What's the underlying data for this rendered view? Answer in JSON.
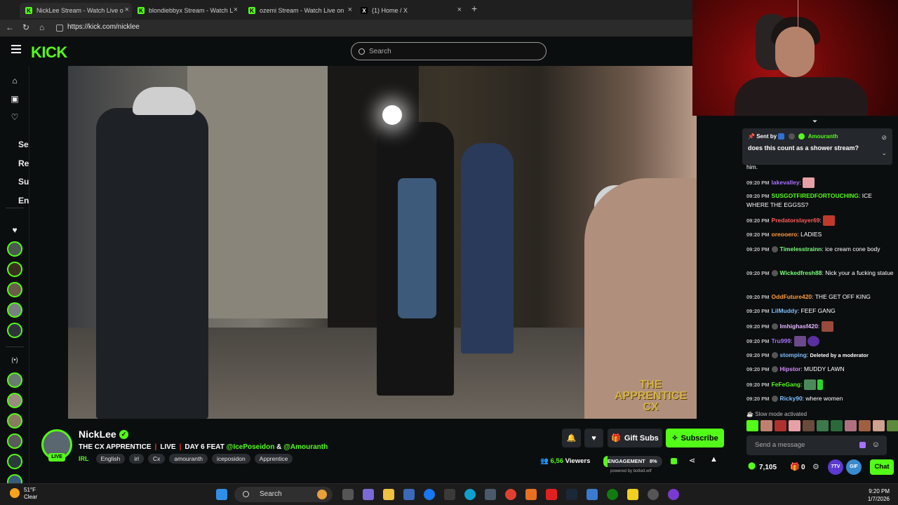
{
  "browser": {
    "tabs": [
      {
        "label": "NickLee Stream - Watch Live o",
        "active": true
      },
      {
        "label": "blondiebbyx Stream - Watch L",
        "active": false
      },
      {
        "label": "ozemi Stream - Watch Live on",
        "active": false
      },
      {
        "label": "(1) Home / X",
        "active": false
      }
    ],
    "new_tab": "+",
    "url": "https://kick.com/nicklee"
  },
  "kick": {
    "logo": "KICK",
    "search_placeholder": "Search",
    "accent": "#53fc18"
  },
  "sidebar": {
    "nav_icons": [
      "home-icon",
      "browse-icon",
      "following-icon"
    ],
    "sections": [
      "Se",
      "Re",
      "Su",
      "En"
    ],
    "live_icon": "(•)"
  },
  "video": {
    "watermark_line1": "THE",
    "watermark_line2": "APPRENTICE",
    "watermark_line3": "CX"
  },
  "chat": {
    "pinned_sent_by": "Sent by",
    "pinned_user": "Amouranth",
    "pinned_message": "does this count as a shower stream?",
    "overflow_text": "him.",
    "messages": [
      {
        "time": "09:20 PM",
        "user": "lakevalley",
        "color": "#a970ff",
        "text": ""
      },
      {
        "time": "09:20 PM",
        "user": "SUSGOTFIREDFORTOUCHING",
        "color": "#53fc18",
        "text": "ICE WHERE THE EGGSS?"
      },
      {
        "time": "09:20 PM",
        "user": "Predatorslayer69",
        "color": "#ff5a5a",
        "text": ""
      },
      {
        "time": "09:20 PM",
        "user": "oreooero",
        "color": "#ff9a3c",
        "text": "LADIES"
      },
      {
        "time": "09:20 PM",
        "user": "Timelesstrainn",
        "color": "#7dff7d",
        "text": "ice cream cone body"
      },
      {
        "time": "09:20 PM",
        "user": "Wickedfresh88",
        "color": "#7dff7d",
        "text": "Nick your a fucking statue"
      },
      {
        "time": "09:20 PM",
        "user": "OddFuture420",
        "color": "#ff9a3c",
        "text": "THE GET OFF KING"
      },
      {
        "time": "09:20 PM",
        "user": "LilMuddy",
        "color": "#7fbfff",
        "text": "FEEF GANG"
      },
      {
        "time": "09:20 PM",
        "user": "Imhighasf420",
        "color": "#e6b8ff",
        "text": ""
      },
      {
        "time": "09:20 PM",
        "user": "Tru999",
        "color": "#a970ff",
        "text": ""
      },
      {
        "time": "09:20 PM",
        "user": "stomping",
        "color": "#7fbfff",
        "text": "Deleted by a moderator"
      },
      {
        "time": "09:20 PM",
        "user": "Hipstor",
        "color": "#d58bff",
        "text": "MUDDY LAWN"
      },
      {
        "time": "09:20 PM",
        "user": "FeFeGang",
        "color": "#53fc18",
        "text": ""
      },
      {
        "time": "09:20 PM",
        "user": "Ricky90",
        "color": "#7fbfff",
        "text": "where women"
      }
    ],
    "slow_mode": "Slow mode activated",
    "input_placeholder": "Send a message",
    "points": "7,105",
    "gift_count": "0",
    "btn_7tv": "7TV",
    "btn_gif": "GIF",
    "send_label": "Chat"
  },
  "stream": {
    "channel": "NickLee",
    "live_label": "LIVE",
    "title_part1": "THE CX APPRENTICE",
    "title_part2": "LIVE",
    "title_part3": "DAY 6 FEAT",
    "mention1": "@IcePoseidon",
    "amp": "&",
    "mention2": "@Amouranth",
    "category": "IRL",
    "tags": [
      "English",
      "irl",
      "Cx",
      "amouranth",
      "iceposidon",
      "Apprentice"
    ],
    "gift_subs": "Gift Subs",
    "subscribe": "Subscribe",
    "viewers_count": "6,56",
    "viewers_label": "Viewers",
    "engagement_label": "ENGAGEMENT",
    "engagement_pct": "8%",
    "powered_by": "powered by botted.wtf"
  },
  "taskbar": {
    "temp": "51°F",
    "condition": "Clear",
    "search": "Search",
    "time": "9:20 PM",
    "date": "1/7/2026"
  }
}
